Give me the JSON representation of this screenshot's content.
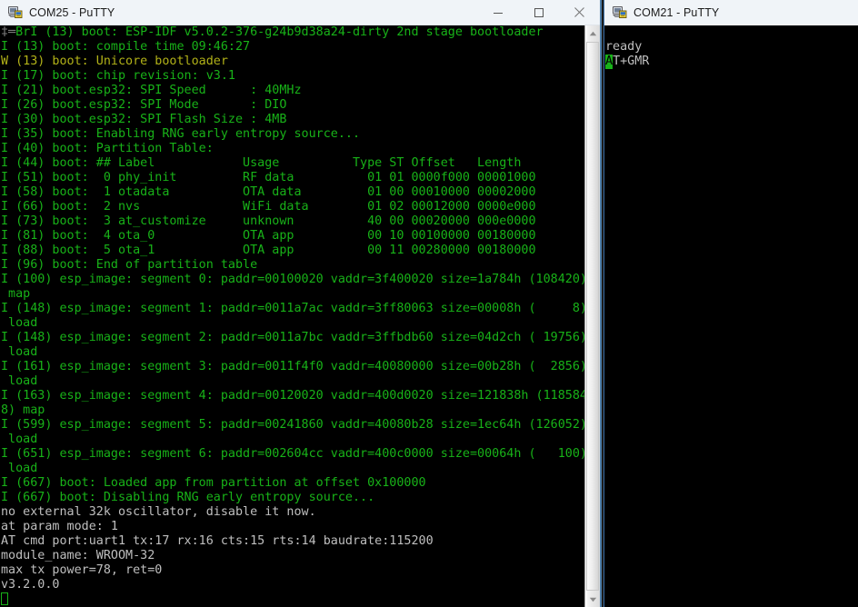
{
  "windows": {
    "left": {
      "title": "COM25 - PuTTY",
      "icon": "putty-computer-icon",
      "buttons": {
        "minimize": "minimize-button",
        "maximize": "maximize-button",
        "close": "close-button"
      },
      "scrollbar": {
        "up_arrow": "scroll-up-arrow",
        "down_arrow": "scroll-down-arrow"
      },
      "terminal_lines": [
        {
          "color": "grey",
          "text": "‡═"
        },
        {
          "color": "green",
          "text": "BrI (13) boot: ESP-IDF v5.0.2-376-g24b9d38a24-dirty 2nd stage bootloader",
          "continues": true
        },
        {
          "color": "green",
          "text": "I (13) boot: compile time 09:46:27"
        },
        {
          "color": "yellow",
          "text": "W (13) boot: Unicore bootloader"
        },
        {
          "color": "green",
          "text": "I (17) boot: chip revision: v3.1"
        },
        {
          "color": "green",
          "text": "I (21) boot.esp32: SPI Speed      : 40MHz"
        },
        {
          "color": "green",
          "text": "I (26) boot.esp32: SPI Mode       : DIO"
        },
        {
          "color": "green",
          "text": "I (30) boot.esp32: SPI Flash Size : 4MB"
        },
        {
          "color": "green",
          "text": "I (35) boot: Enabling RNG early entropy source..."
        },
        {
          "color": "green",
          "text": "I (40) boot: Partition Table:"
        },
        {
          "color": "green",
          "text": "I (44) boot: ## Label            Usage          Type ST Offset   Length"
        },
        {
          "color": "green",
          "text": "I (51) boot:  0 phy_init         RF data          01 01 0000f000 00001000"
        },
        {
          "color": "green",
          "text": "I (58) boot:  1 otadata          OTA data         01 00 00010000 00002000"
        },
        {
          "color": "green",
          "text": "I (66) boot:  2 nvs              WiFi data        01 02 00012000 0000e000"
        },
        {
          "color": "green",
          "text": "I (73) boot:  3 at_customize     unknown          40 00 00020000 000e0000"
        },
        {
          "color": "green",
          "text": "I (81) boot:  4 ota_0            OTA app          00 10 00100000 00180000"
        },
        {
          "color": "green",
          "text": "I (88) boot:  5 ota_1            OTA app          00 11 00280000 00180000"
        },
        {
          "color": "green",
          "text": "I (96) boot: End of partition table"
        },
        {
          "color": "green",
          "text": "I (100) esp_image: segment 0: paddr=00100020 vaddr=3f400020 size=1a784h (108420)"
        },
        {
          "color": "green",
          "text": " map"
        },
        {
          "color": "green",
          "text": "I (148) esp_image: segment 1: paddr=0011a7ac vaddr=3ff80063 size=00008h (     8)"
        },
        {
          "color": "green",
          "text": " load"
        },
        {
          "color": "green",
          "text": "I (148) esp_image: segment 2: paddr=0011a7bc vaddr=3ffbdb60 size=04d2ch ( 19756)"
        },
        {
          "color": "green",
          "text": " load"
        },
        {
          "color": "green",
          "text": "I (161) esp_image: segment 3: paddr=0011f4f0 vaddr=40080000 size=00b28h (  2856)"
        },
        {
          "color": "green",
          "text": " load"
        },
        {
          "color": "green",
          "text": "I (163) esp_image: segment 4: paddr=00120020 vaddr=400d0020 size=121838h (118584"
        },
        {
          "color": "green",
          "text": "8) map"
        },
        {
          "color": "green",
          "text": "I (599) esp_image: segment 5: paddr=00241860 vaddr=40080b28 size=1ec64h (126052)"
        },
        {
          "color": "green",
          "text": " load"
        },
        {
          "color": "green",
          "text": "I (651) esp_image: segment 6: paddr=002604cc vaddr=400c0000 size=00064h (   100)"
        },
        {
          "color": "green",
          "text": " load"
        },
        {
          "color": "green",
          "text": "I (667) boot: Loaded app from partition at offset 0x100000"
        },
        {
          "color": "green",
          "text": "I (667) boot: Disabling RNG early entropy source..."
        },
        {
          "color": "white",
          "text": "no external 32k oscillator, disable it now."
        },
        {
          "color": "white",
          "text": "at param mode: 1"
        },
        {
          "color": "white",
          "text": "AT cmd port:uart1 tx:17 rx:16 cts:15 rts:14 baudrate:115200"
        },
        {
          "color": "white",
          "text": "module_name: WROOM-32"
        },
        {
          "color": "white",
          "text": "max tx power=78, ret=0"
        },
        {
          "color": "white",
          "text": "v3.2.0.0"
        }
      ]
    },
    "right": {
      "title": "COM21 - PuTTY",
      "icon": "putty-computer-icon",
      "terminal_lines": [
        {
          "color": "white",
          "text": ""
        },
        {
          "color": "white",
          "text": "ready"
        }
      ],
      "command_line": {
        "cursor_char": "A",
        "rest": "T+GMR"
      }
    }
  },
  "colors": {
    "terminal_background": "#000000",
    "ansi_green": "#18b218",
    "ansi_yellow": "#b2b218",
    "foreground_white": "#bfbfbf",
    "cursor_green": "#18b218",
    "titlebar_background": "#f0f4f8",
    "window_border_blue": "#3a6ea5"
  }
}
